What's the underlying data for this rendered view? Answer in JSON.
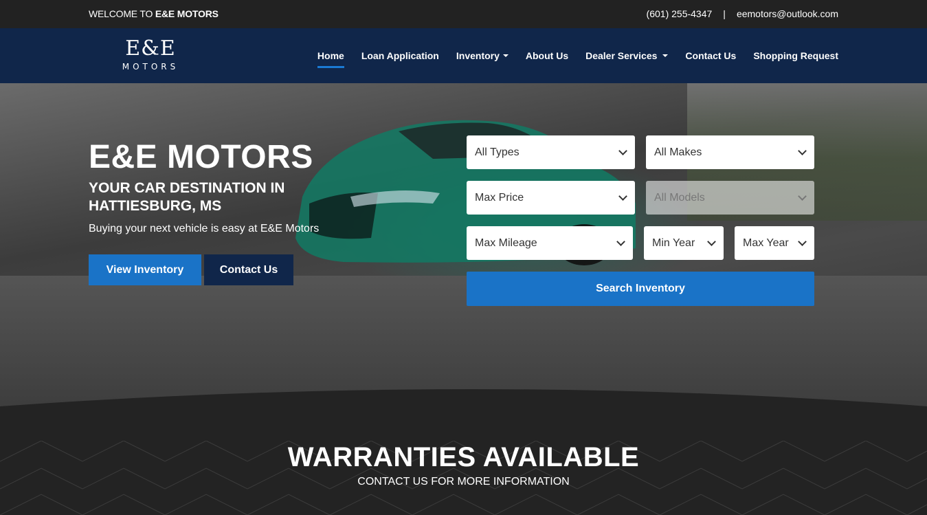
{
  "topbar": {
    "welcome_prefix": "WELCOME TO",
    "welcome_brand": "E&E MOTORS",
    "phone": "(601) 255-4347",
    "separator": "|",
    "email": "eemotors@outlook.com"
  },
  "logo": {
    "line1": "E&E",
    "line2": "MOTORS"
  },
  "nav": {
    "items": [
      {
        "label": "Home",
        "active": true
      },
      {
        "label": "Loan Application"
      },
      {
        "label": "Inventory",
        "dropdown": true
      },
      {
        "label": "About Us"
      },
      {
        "label": "Dealer Services",
        "dropdown": true
      },
      {
        "label": "Contact Us"
      },
      {
        "label": "Shopping Request"
      }
    ]
  },
  "hero": {
    "title": "E&E MOTORS",
    "subtitle": "YOUR CAR DESTINATION IN HATTIESBURG, MS",
    "description": "Buying your next vehicle is easy at E&E Motors",
    "primary_button": "View Inventory",
    "secondary_button": "Contact Us"
  },
  "search": {
    "type": "All Types",
    "make": "All Makes",
    "price": "Max Price",
    "model": "All Models",
    "mileage": "Max Mileage",
    "min_year": "Min Year",
    "max_year": "Max Year",
    "submit": "Search Inventory"
  },
  "warranty": {
    "title": "WARRANTIES AVAILABLE",
    "subtitle": "CONTACT US FOR MORE INFORMATION"
  },
  "colors": {
    "navy": "#10264a",
    "accent_blue": "#1a73c7",
    "dark": "#222222"
  }
}
